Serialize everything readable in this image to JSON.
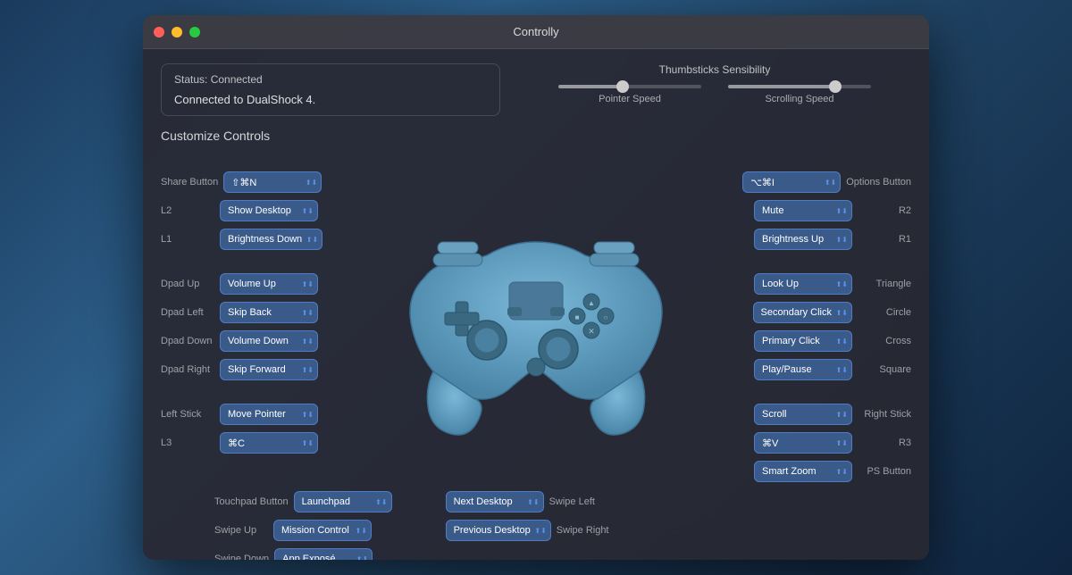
{
  "window": {
    "title": "Controlly"
  },
  "status": {
    "label": "Status: Connected",
    "value": "Connected to DualShock 4."
  },
  "thumbsticks": {
    "title": "Thumbsticks Sensibility",
    "pointer_speed": {
      "label": "Pointer Speed",
      "position": 45
    },
    "scrolling_speed": {
      "label": "Scrolling Speed",
      "position": 75
    }
  },
  "customize_title": "Customize Controls",
  "left_controls": [
    {
      "label": "Share Button",
      "value": "⇧⌘N"
    },
    {
      "label": "L2",
      "value": "Show Desktop"
    },
    {
      "label": "L1",
      "value": "Brightness Down"
    },
    {
      "label": "",
      "value": ""
    },
    {
      "label": "Dpad Up",
      "value": "Volume Up"
    },
    {
      "label": "Dpad Left",
      "value": "Skip Back"
    },
    {
      "label": "Dpad Down",
      "value": "Volume Down"
    },
    {
      "label": "Dpad Right",
      "value": "Skip Forward"
    },
    {
      "label": "",
      "value": ""
    },
    {
      "label": "Left Stick",
      "value": "Move Pointer"
    },
    {
      "label": "L3",
      "value": "⌘C"
    }
  ],
  "right_controls": [
    {
      "label": "Options Button",
      "value": "⌥⌘I"
    },
    {
      "label": "R2",
      "value": "Mute"
    },
    {
      "label": "R1",
      "value": "Brightness Up"
    },
    {
      "label": "",
      "value": ""
    },
    {
      "label": "Triangle",
      "value": "Look Up"
    },
    {
      "label": "Circle",
      "value": "Secondary Click"
    },
    {
      "label": "Cross",
      "value": "Primary Click"
    },
    {
      "label": "Square",
      "value": "Play/Pause"
    },
    {
      "label": "",
      "value": ""
    },
    {
      "label": "Right Stick",
      "value": "Scroll"
    },
    {
      "label": "R3",
      "value": "⌘V"
    },
    {
      "label": "PS Button",
      "value": "Smart Zoom"
    }
  ],
  "bottom_controls": {
    "left": [
      {
        "label": "Touchpad Button",
        "value": "Launchpad"
      },
      {
        "label": "Swipe Up",
        "value": "Mission Control"
      },
      {
        "label": "Swipe Down",
        "value": "App Exposé"
      }
    ],
    "right": [
      {
        "label": "Swipe Left",
        "value": "Next Desktop"
      },
      {
        "label": "Swipe Right",
        "value": "Previous Desktop"
      }
    ]
  },
  "colors": {
    "dropdown_bg": "#3a5a8a",
    "accent": "#4a8acf"
  }
}
